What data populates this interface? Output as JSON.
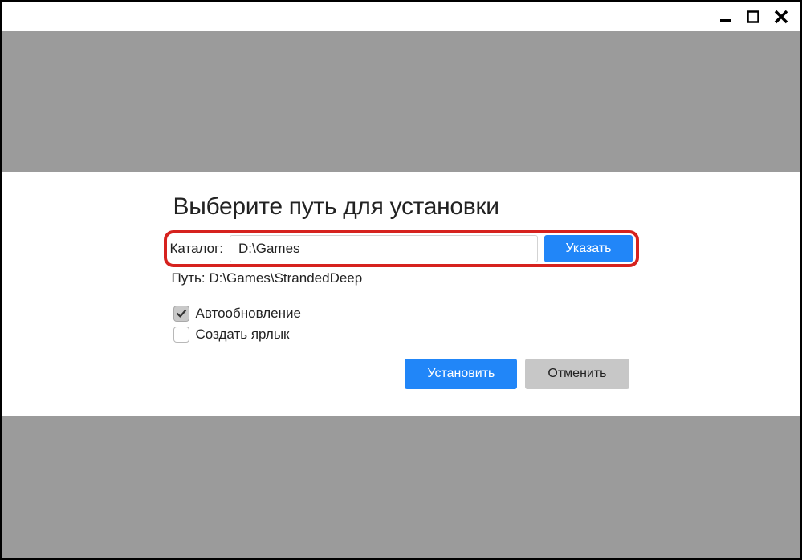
{
  "dialog": {
    "heading": "Выберите путь для установки",
    "catalog_label": "Каталог:",
    "catalog_value": "D:\\Games",
    "browse_button": "Указать",
    "path_label": "Путь:",
    "path_value": "D:\\Games\\StrandedDeep",
    "auto_update_label": "Автообновление",
    "auto_update_checked": true,
    "create_shortcut_label": "Создать ярлык",
    "create_shortcut_checked": false,
    "install_button": "Установить",
    "cancel_button": "Отменить"
  },
  "colors": {
    "primary": "#2186f8",
    "secondary_bg": "#c7c7c7",
    "highlight": "#d6221e",
    "panel_bg": "#9b9b9b"
  }
}
